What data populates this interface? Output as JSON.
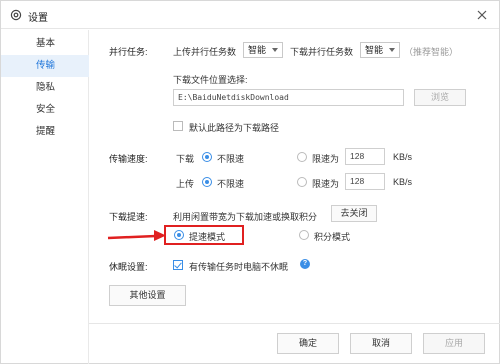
{
  "window": {
    "title": "设置"
  },
  "sidebar": {
    "items": [
      {
        "label": "基本",
        "active": false
      },
      {
        "label": "传输",
        "active": true
      },
      {
        "label": "隐私",
        "active": false
      },
      {
        "label": "安全",
        "active": false
      },
      {
        "label": "提醒",
        "active": false
      }
    ]
  },
  "parallel": {
    "section_label": "并行任务:",
    "upload_label": "上传并行任务数",
    "upload_value": "智能",
    "download_label": "下载并行任务数",
    "download_value": "智能",
    "recommend_note": "（推荐智能）"
  },
  "download_location": {
    "label": "下载文件位置选择:",
    "path": "E:\\BaiduNetdiskDownload",
    "browse_button": "浏览",
    "default_checkbox_label": "默认此路径为下载路径",
    "default_checked": false
  },
  "speed": {
    "section_label": "传输速度:",
    "download": {
      "label": "下载",
      "unlimited_label": "不限速",
      "limit_label": "限速为",
      "limit_value": "128",
      "unit": "KB/s",
      "unlimited_selected": true
    },
    "upload": {
      "label": "上传",
      "unlimited_label": "不限速",
      "limit_label": "限速为",
      "limit_value": "128",
      "unit": "KB/s",
      "unlimited_selected": true
    }
  },
  "boost": {
    "section_label": "下载提速:",
    "description": "利用闲置带宽为下载加速或换取积分",
    "toggle_button": "去关闭",
    "speed_mode_label": "提速模式",
    "points_mode_label": "积分模式",
    "speed_mode_selected": true
  },
  "sleep": {
    "section_label": "休眠设置:",
    "checkbox_label": "有传输任务时电脑不休眠",
    "checked": true
  },
  "other_settings_button": "其他设置",
  "footer": {
    "ok": "确定",
    "cancel": "取消",
    "apply": "应用"
  },
  "colors": {
    "accent": "#3a8ee6",
    "active_bg": "#e8f1fb",
    "annotation_red": "#e02020"
  }
}
